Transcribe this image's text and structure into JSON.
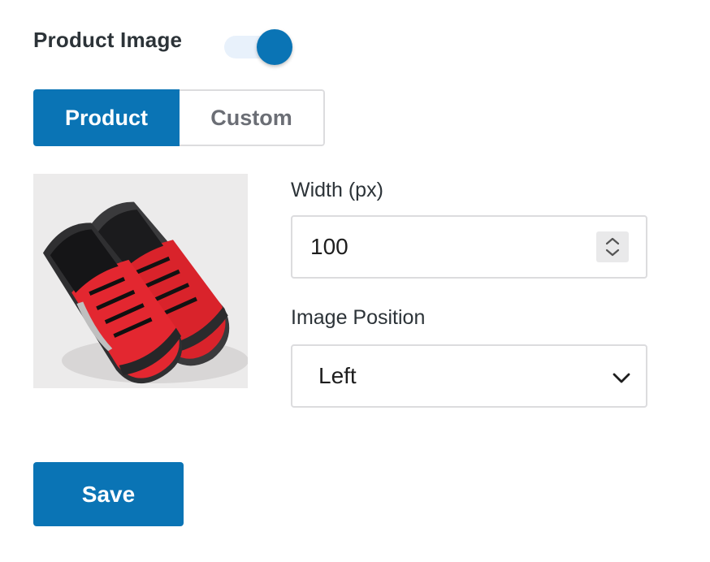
{
  "product_image": {
    "title": "Product Image",
    "toggle_on": true
  },
  "source_tabs": {
    "items": [
      {
        "label": "Product",
        "active": true
      },
      {
        "label": "Custom",
        "active": false
      }
    ]
  },
  "width_field": {
    "label": "Width (px)",
    "value": "100"
  },
  "position_field": {
    "label": "Image Position",
    "value": "Left"
  },
  "save_label": "Save",
  "icons": {
    "spinner": "up-down-spinner-icon",
    "select": "chevron-down-icon"
  },
  "colors": {
    "accent": "#0a74b5",
    "toggle_track": "#e8f1fb",
    "border": "#dcdcde"
  }
}
